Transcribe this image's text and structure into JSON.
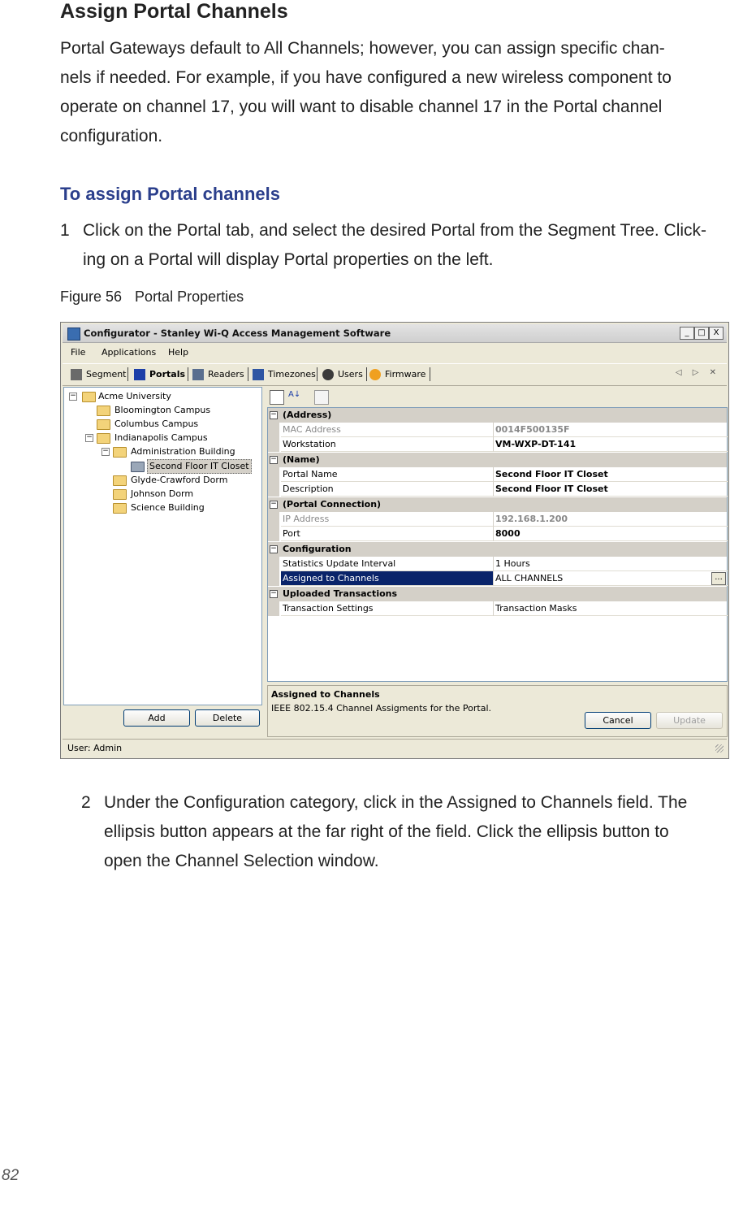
{
  "heading": "Assign Portal Channels",
  "intro_lines": [
    "Portal Gateways default to All Channels; however, you can assign specific chan-",
    "nels if needed. For example, if you have configured a new wireless component to",
    "operate on channel 17, you will want to disable channel 17 in the Portal channel",
    "configuration."
  ],
  "subheading": "To assign Portal channels",
  "step1": {
    "num": "1",
    "lines": [
      "Click on the Portal tab, and select the desired Portal from the Segment Tree. Click-",
      "ing on a Portal will display Portal properties on the left."
    ]
  },
  "figure": {
    "label": "Figure 56",
    "title": "Portal Properties"
  },
  "window": {
    "title": "Configurator - Stanley Wi-Q Access Management Software",
    "controls": [
      "_",
      "□",
      "X"
    ],
    "menu": [
      "File",
      "Applications",
      "Help"
    ],
    "tabs": [
      {
        "label": "Segment",
        "icon": "segment-icon"
      },
      {
        "label": "Portals",
        "icon": "portals-icon"
      },
      {
        "label": "Readers",
        "icon": "readers-icon"
      },
      {
        "label": "Timezones",
        "icon": "timezones-icon"
      },
      {
        "label": "Users",
        "icon": "users-icon"
      },
      {
        "label": "Firmware",
        "icon": "firmware-icon"
      }
    ],
    "nav_arrows": "◁ ▷ ✕",
    "tree": [
      {
        "label": "Acme University",
        "toggle": "−"
      },
      {
        "label": "Bloomington Campus"
      },
      {
        "label": "Columbus Campus"
      },
      {
        "label": "Indianapolis Campus",
        "toggle": "−"
      },
      {
        "label": "Administration Building",
        "toggle": "−"
      },
      {
        "label": "Second Floor IT Closet",
        "selected": true
      },
      {
        "label": "Glyde-Crawford Dorm"
      },
      {
        "label": "Johnson Dorm"
      },
      {
        "label": "Science Building"
      }
    ],
    "tree_buttons": {
      "add": "Add",
      "delete": "Delete"
    },
    "properties": [
      {
        "category": "(Address)"
      },
      {
        "key": "MAC Address",
        "value": "0014F500135F",
        "readonly": true,
        "bold": true
      },
      {
        "key": "Workstation",
        "value": "VM-WXP-DT-141",
        "bold": true
      },
      {
        "category": "(Name)"
      },
      {
        "key": "Portal Name",
        "value": "Second Floor IT Closet",
        "bold": true
      },
      {
        "key": "Description",
        "value": "Second Floor IT Closet",
        "bold": true
      },
      {
        "category": "(Portal Connection)"
      },
      {
        "key": "IP Address",
        "value": "192.168.1.200",
        "readonly": true,
        "bold": true
      },
      {
        "key": "Port",
        "value": "8000",
        "bold": true
      },
      {
        "category": "Configuration"
      },
      {
        "key": "Statistics Update Interval",
        "value": "1 Hours"
      },
      {
        "key": "Assigned to Channels",
        "value": "ALL CHANNELS",
        "highlight": true,
        "ellipsis": "..."
      },
      {
        "category": "Uploaded Transactions"
      },
      {
        "key": "Transaction Settings",
        "value": "Transaction Masks"
      }
    ],
    "description": {
      "title": "Assigned to Channels",
      "text": "IEEE 802.15.4 Channel Assigments for the Portal."
    },
    "buttons": {
      "cancel": "Cancel",
      "update": "Update"
    },
    "status": "User: Admin"
  },
  "step2": {
    "num": "2",
    "lines": [
      "Under the Configuration category, click in the Assigned to Channels field. The",
      "ellipsis button appears at the far right of the field. Click the ellipsis button to",
      "open the Channel Selection window."
    ]
  },
  "page_number": "82",
  "colors": {
    "subheading": "#2b3f8c",
    "selection": "#0a246a",
    "window_bg": "#ece9d8"
  }
}
